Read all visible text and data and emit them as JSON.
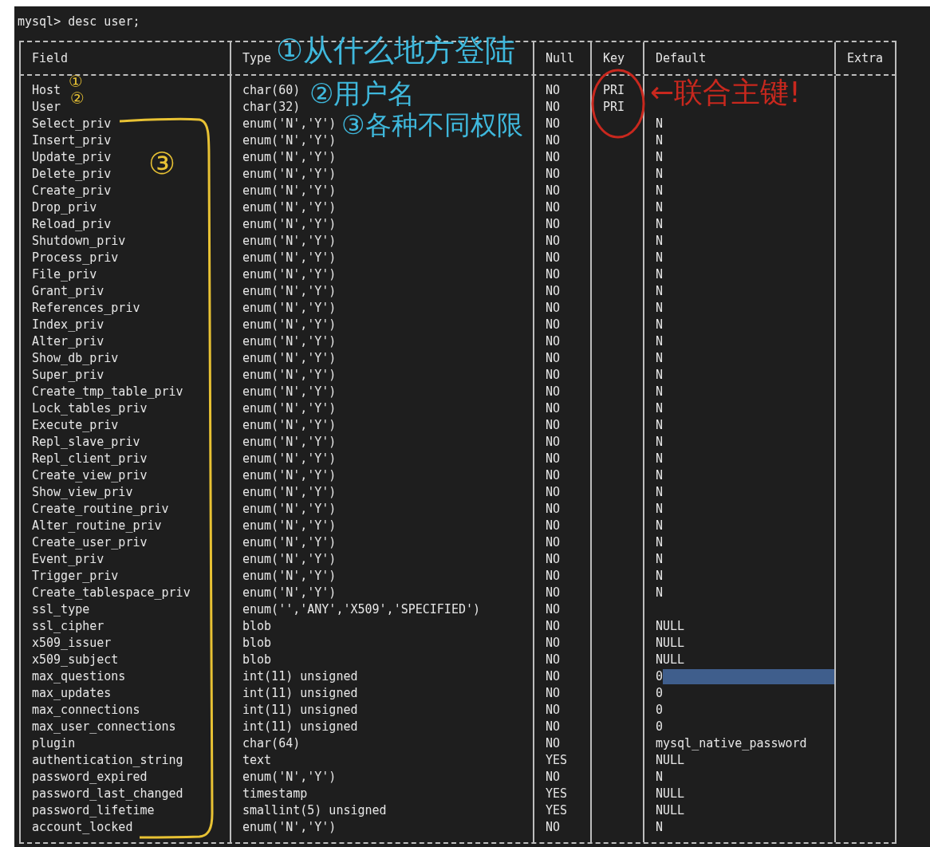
{
  "prompt": "mysql> desc user;",
  "columns": [
    "Field",
    "Type",
    "Null",
    "Key",
    "Default",
    "Extra"
  ],
  "rows": [
    {
      "field": "Host",
      "type": "char(60)",
      "null": "NO",
      "key": "PRI"
    },
    {
      "field": "User",
      "type": "char(32)",
      "null": "NO",
      "key": "PRI"
    },
    {
      "field": "Select_priv",
      "type": "enum('N','Y')",
      "null": "NO",
      "default": "N"
    },
    {
      "field": "Insert_priv",
      "type": "enum('N','Y')",
      "null": "NO",
      "default": "N"
    },
    {
      "field": "Update_priv",
      "type": "enum('N','Y')",
      "null": "NO",
      "default": "N"
    },
    {
      "field": "Delete_priv",
      "type": "enum('N','Y')",
      "null": "NO",
      "default": "N"
    },
    {
      "field": "Create_priv",
      "type": "enum('N','Y')",
      "null": "NO",
      "default": "N"
    },
    {
      "field": "Drop_priv",
      "type": "enum('N','Y')",
      "null": "NO",
      "default": "N"
    },
    {
      "field": "Reload_priv",
      "type": "enum('N','Y')",
      "null": "NO",
      "default": "N"
    },
    {
      "field": "Shutdown_priv",
      "type": "enum('N','Y')",
      "null": "NO",
      "default": "N"
    },
    {
      "field": "Process_priv",
      "type": "enum('N','Y')",
      "null": "NO",
      "default": "N"
    },
    {
      "field": "File_priv",
      "type": "enum('N','Y')",
      "null": "NO",
      "default": "N"
    },
    {
      "field": "Grant_priv",
      "type": "enum('N','Y')",
      "null": "NO",
      "default": "N"
    },
    {
      "field": "References_priv",
      "type": "enum('N','Y')",
      "null": "NO",
      "default": "N"
    },
    {
      "field": "Index_priv",
      "type": "enum('N','Y')",
      "null": "NO",
      "default": "N"
    },
    {
      "field": "Alter_priv",
      "type": "enum('N','Y')",
      "null": "NO",
      "default": "N"
    },
    {
      "field": "Show_db_priv",
      "type": "enum('N','Y')",
      "null": "NO",
      "default": "N"
    },
    {
      "field": "Super_priv",
      "type": "enum('N','Y')",
      "null": "NO",
      "default": "N"
    },
    {
      "field": "Create_tmp_table_priv",
      "type": "enum('N','Y')",
      "null": "NO",
      "default": "N"
    },
    {
      "field": "Lock_tables_priv",
      "type": "enum('N','Y')",
      "null": "NO",
      "default": "N"
    },
    {
      "field": "Execute_priv",
      "type": "enum('N','Y')",
      "null": "NO",
      "default": "N"
    },
    {
      "field": "Repl_slave_priv",
      "type": "enum('N','Y')",
      "null": "NO",
      "default": "N"
    },
    {
      "field": "Repl_client_priv",
      "type": "enum('N','Y')",
      "null": "NO",
      "default": "N"
    },
    {
      "field": "Create_view_priv",
      "type": "enum('N','Y')",
      "null": "NO",
      "default": "N"
    },
    {
      "field": "Show_view_priv",
      "type": "enum('N','Y')",
      "null": "NO",
      "default": "N"
    },
    {
      "field": "Create_routine_priv",
      "type": "enum('N','Y')",
      "null": "NO",
      "default": "N"
    },
    {
      "field": "Alter_routine_priv",
      "type": "enum('N','Y')",
      "null": "NO",
      "default": "N"
    },
    {
      "field": "Create_user_priv",
      "type": "enum('N','Y')",
      "null": "NO",
      "default": "N"
    },
    {
      "field": "Event_priv",
      "type": "enum('N','Y')",
      "null": "NO",
      "default": "N"
    },
    {
      "field": "Trigger_priv",
      "type": "enum('N','Y')",
      "null": "NO",
      "default": "N"
    },
    {
      "field": "Create_tablespace_priv",
      "type": "enum('N','Y')",
      "null": "NO",
      "default": "N"
    },
    {
      "field": "ssl_type",
      "type": "enum('','ANY','X509','SPECIFIED')",
      "null": "NO"
    },
    {
      "field": "ssl_cipher",
      "type": "blob",
      "null": "NO",
      "default": "NULL"
    },
    {
      "field": "x509_issuer",
      "type": "blob",
      "null": "NO",
      "default": "NULL"
    },
    {
      "field": "x509_subject",
      "type": "blob",
      "null": "NO",
      "default": "NULL"
    },
    {
      "field": "max_questions",
      "type": "int(11) unsigned",
      "null": "NO",
      "default": "0",
      "highlighted": true
    },
    {
      "field": "max_updates",
      "type": "int(11) unsigned",
      "null": "NO",
      "default": "0"
    },
    {
      "field": "max_connections",
      "type": "int(11) unsigned",
      "null": "NO",
      "default": "0"
    },
    {
      "field": "max_user_connections",
      "type": "int(11) unsigned",
      "null": "NO",
      "default": "0"
    },
    {
      "field": "plugin",
      "type": "char(64)",
      "null": "NO",
      "default": "mysql_native_password"
    },
    {
      "field": "authentication_string",
      "type": "text",
      "null": "YES",
      "default": "NULL"
    },
    {
      "field": "password_expired",
      "type": "enum('N','Y')",
      "null": "NO",
      "default": "N"
    },
    {
      "field": "password_last_changed",
      "type": "timestamp",
      "null": "YES",
      "default": "NULL"
    },
    {
      "field": "password_lifetime",
      "type": "smallint(5) unsigned",
      "null": "YES",
      "default": "NULL"
    },
    {
      "field": "account_locked",
      "type": "enum('N','Y')",
      "null": "NO",
      "default": "N"
    }
  ],
  "annotations": [
    {
      "text": "①从什么地方登陆",
      "color": "#3fb8dc"
    },
    {
      "text": "①",
      "color": "#e8c234"
    },
    {
      "text": "②",
      "color": "#e8c234"
    },
    {
      "text": "②用户名",
      "color": "#3fb8dc"
    },
    {
      "text": "←联合主键!",
      "color": "#c8281e"
    },
    {
      "text": "③各种不同权限",
      "color": "#3fb8dc"
    },
    {
      "text": "③",
      "color": "#e8c234"
    }
  ]
}
